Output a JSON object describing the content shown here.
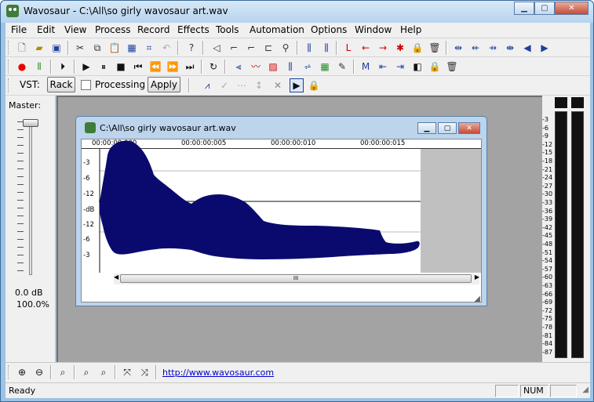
{
  "window": {
    "title": "Wavosaur - C:\\All\\so girly wavosaur art.wav"
  },
  "menu": [
    "File",
    "Edit",
    "View",
    "Process",
    "Record",
    "Effects",
    "Tools",
    "Automation",
    "Options",
    "Window",
    "Help"
  ],
  "vst": {
    "label": "VST:",
    "rack": "Rack",
    "processing": "Processing",
    "apply": "Apply"
  },
  "master": {
    "label": "Master:",
    "db": "0.0 dB",
    "percent": "100.0%"
  },
  "document": {
    "title": "C:\\All\\so girly wavosaur art.wav",
    "ruler": [
      "00:00:00:000",
      "00:00:00:005",
      "00:00:00:010",
      "00:00:00:015"
    ],
    "db_labels": [
      "-3",
      "-6",
      "-12",
      "-dB",
      "-12",
      "-6",
      "-3"
    ],
    "scroll_grip": "III"
  },
  "vu_scale": [
    "-3",
    "-6",
    "-9",
    "-12",
    "-15",
    "-18",
    "-21",
    "-24",
    "-27",
    "-30",
    "-33",
    "-36",
    "-39",
    "-42",
    "-45",
    "-48",
    "-51",
    "-54",
    "-57",
    "-60",
    "-63",
    "-66",
    "-69",
    "-72",
    "-75",
    "-78",
    "-81",
    "-84",
    "-87"
  ],
  "bottom": {
    "url": "http://www.wavosaur.com"
  },
  "status": {
    "text": "Ready",
    "num": "NUM"
  },
  "colors": {
    "waveform": "#0a0a6e",
    "workspace": "#a3a3a3",
    "titlebar": "#b6d3ee"
  }
}
